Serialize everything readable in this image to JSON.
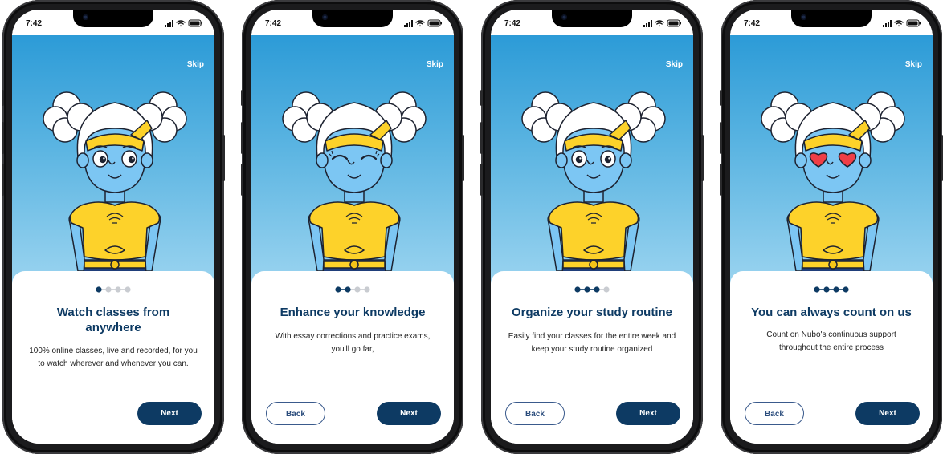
{
  "status_time": "7:42",
  "skip_label": "Skip",
  "back_label": "Back",
  "next_label": "Next",
  "colors": {
    "navy": "#0d3a63",
    "sky_top": "#2c9bd7",
    "sky_bottom": "#9dd5f0",
    "shirt": "#fdd22a",
    "skin": "#7cc6f3"
  },
  "screens": [
    {
      "step": 1,
      "total_steps": 4,
      "eyes": "open-glancing",
      "title": "Watch classes from anywhere",
      "title_lines": [
        "Watch classes from",
        "anywhere"
      ],
      "description_lines": [
        "100% online classes, live and recorded, for you",
        "to watch wherever and whenever you can."
      ],
      "has_back": false
    },
    {
      "step": 2,
      "total_steps": 4,
      "eyes": "closed-smiling",
      "title": "Enhance your knowledge",
      "title_lines": [
        "Enhance your knowledge"
      ],
      "description_lines": [
        "With essay corrections and practice exams,",
        "you'll go far,"
      ],
      "has_back": true
    },
    {
      "step": 3,
      "total_steps": 4,
      "eyes": "open-wide",
      "title": "Organize your study routine",
      "title_lines": [
        "Organize your study routine"
      ],
      "description_lines": [
        "Easily find your classes for the entire week and",
        "keep your study routine organized"
      ],
      "has_back": true
    },
    {
      "step": 4,
      "total_steps": 4,
      "eyes": "heart-eyes",
      "title": "You can always count on us",
      "title_lines": [
        "You can always count on us"
      ],
      "description_lines": [
        "Count on Nubo's continuous support",
        "throughout the entire process"
      ],
      "has_back": true
    }
  ]
}
